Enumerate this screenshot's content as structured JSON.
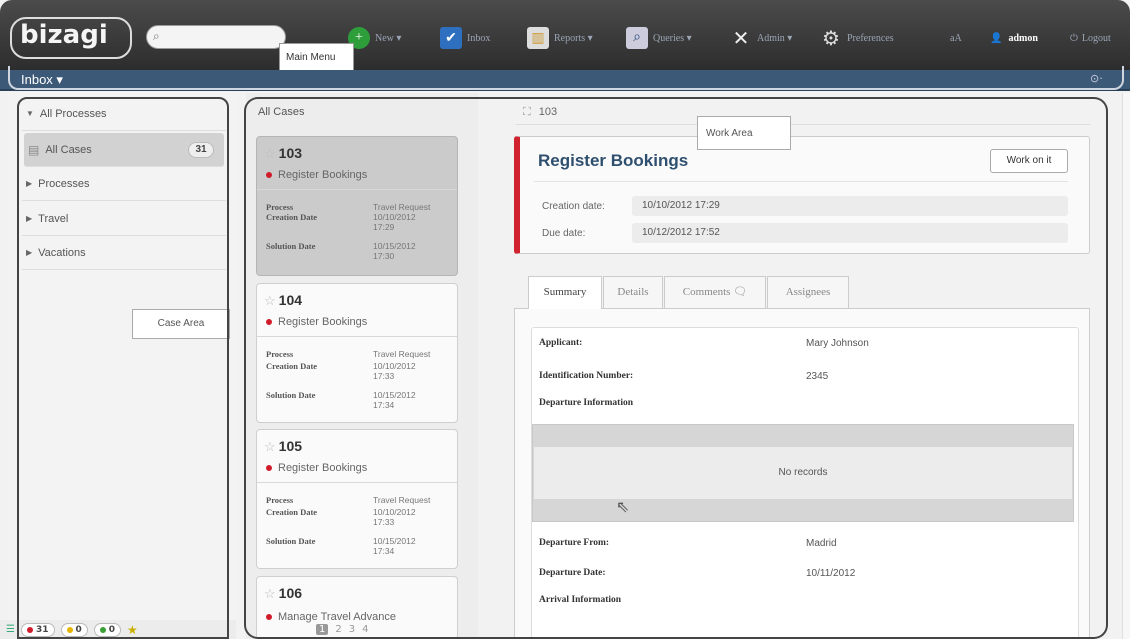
{
  "header": {
    "logo": "bizagi",
    "search_placeholder": "",
    "menu": [
      {
        "label": "New ▾",
        "icon": "new-plus-icon"
      },
      {
        "label": "Inbox",
        "icon": "inbox-check-icon"
      },
      {
        "label": "Reports ▾",
        "icon": "reports-chart-icon"
      },
      {
        "label": "Queries ▾",
        "icon": "queries-icon"
      },
      {
        "label": "Admin ▾",
        "icon": "admin-tools-icon"
      },
      {
        "label": "Preferences",
        "icon": "gear-icon"
      },
      {
        "label": "aA",
        "icon": "font-size-icon"
      },
      {
        "label": "admon",
        "icon": "user-icon"
      },
      {
        "label": "Logout",
        "icon": "power-icon"
      }
    ],
    "inbox_label": "Inbox ▾",
    "callout": "Main Menu"
  },
  "case_area": {
    "items": [
      {
        "label": "All Processes"
      },
      {
        "label": "All Cases",
        "badge": "31"
      },
      {
        "label": "Processes"
      },
      {
        "label": "Travel"
      },
      {
        "label": "Vacations"
      }
    ],
    "callout": "Case Area",
    "status": {
      "red": "31",
      "yellow": "0",
      "green": "0"
    }
  },
  "case_list": {
    "title": "All Cases",
    "cards": [
      {
        "number": "103",
        "task": "Register Bookings",
        "process_label": "Process",
        "process": "Travel Request",
        "creation_label": "Creation Date",
        "creation": "10/10/2012 17:29",
        "solution_label": "Solution Date",
        "solution": "10/15/2012 17:30"
      },
      {
        "number": "104",
        "task": "Register Bookings",
        "process_label": "Process",
        "process": "Travel Request",
        "creation_label": "Creation Date",
        "creation": "10/10/2012 17:33",
        "solution_label": "Solution Date",
        "solution": "10/15/2012 17:34"
      },
      {
        "number": "105",
        "task": "Register Bookings",
        "process_label": "Process",
        "process": "Travel Request",
        "creation_label": "Creation Date",
        "creation": "10/10/2012 17:33",
        "solution_label": "Solution Date",
        "solution": "10/15/2012 17:34"
      },
      {
        "number": "106",
        "task": "Manage Travel Advance"
      }
    ],
    "pages": [
      "1",
      "2",
      "3",
      "4"
    ]
  },
  "work_area": {
    "case_number": "103",
    "callout": "Work Area",
    "title": "Register Bookings",
    "work_button": "Work on it",
    "creation_label": "Creation date:",
    "creation_value": "10/10/2012 17:29",
    "due_label": "Due date:",
    "due_value": "10/12/2012 17:52",
    "tabs": [
      "Summary",
      "Details",
      "Comments",
      "Assignees"
    ],
    "fields": {
      "applicant_label": "Applicant:",
      "applicant_value": "Mary Johnson",
      "id_label": "Identification Number:",
      "id_value": "2345",
      "departure_info": "Departure Information",
      "no_records": "No records",
      "departure_from_label": "Departure From:",
      "departure_from_value": "Madrid",
      "departure_date_label": "Departure Date:",
      "departure_date_value": "10/11/2012",
      "arrival_info": "Arrival Information"
    }
  },
  "colors": {
    "accent_red": "#d0232f",
    "title_blue": "#2f4f6f",
    "subbar": "#3c5a78"
  }
}
